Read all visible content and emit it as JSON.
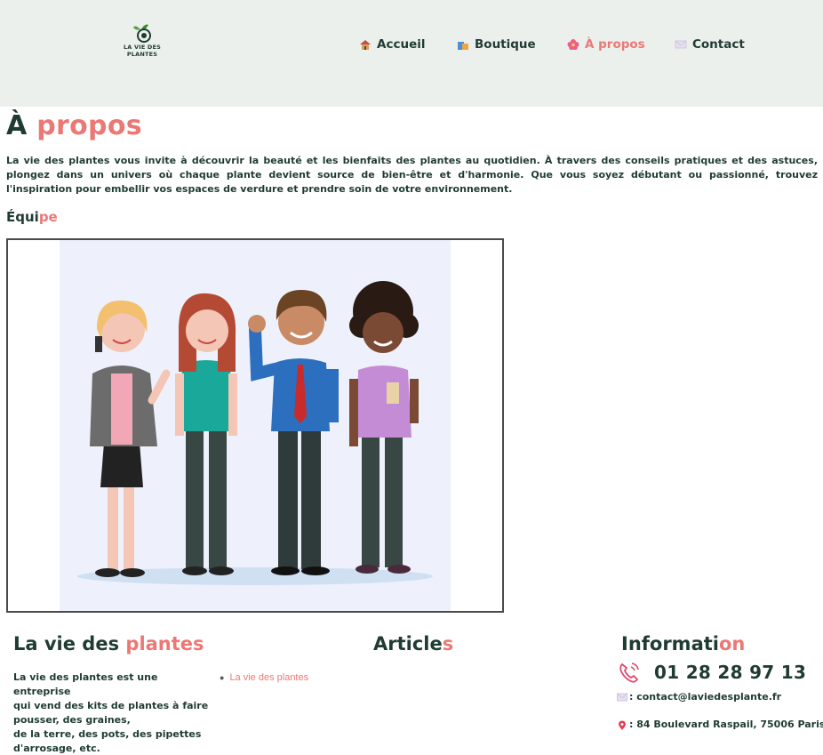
{
  "brand": {
    "logo_line1": "LA VIE DES",
    "logo_line2": "PLANTES"
  },
  "nav": [
    {
      "label": "Accueil",
      "icon": "house-icon"
    },
    {
      "label": "Boutique",
      "icon": "shopping-bags-icon"
    },
    {
      "label": "À propos",
      "icon": "flower-icon",
      "active": true
    },
    {
      "label": "Contact",
      "icon": "envelope-icon"
    }
  ],
  "page": {
    "title_part1": "À",
    "title_part2": "propos",
    "intro": "La vie des plantes vous invite à découvrir la beauté et les bienfaits des plantes au quotidien. À travers des conseils pratiques et des astuces, plongez dans un univers où chaque plante devient source de bien-être et d'harmonie. Que vous soyez débutant ou passionné, trouvez l'inspiration pour embellir vos espaces de verdure et prendre soin de votre environnement.",
    "team_title_part1": "Équi",
    "team_title_part2": "pe"
  },
  "footer": {
    "about": {
      "title_part1": "La vie des",
      "title_part2": "plantes",
      "text_lines": [
        "La vie des plantes est une entreprise",
        "qui vend des kits de plantes à faire",
        "pousser, des graines,",
        "de la terre, des pots, des pipettes",
        "d'arrosage, etc."
      ]
    },
    "articles": {
      "title_part1": "Article",
      "title_part2": "s",
      "items": [
        "La vie des plantes"
      ]
    },
    "info": {
      "title_part1": "Informati",
      "title_part2": "on",
      "phone": "01 28 28 97 13",
      "email": ": contact@laviedesplante.fr",
      "address": ": 84 Boulevard Raspail, 75006 Paris"
    }
  },
  "colors": {
    "dark_green": "#1f3b33",
    "accent_pink": "#ec7875",
    "topbar_bg": "#ecf0ed"
  }
}
